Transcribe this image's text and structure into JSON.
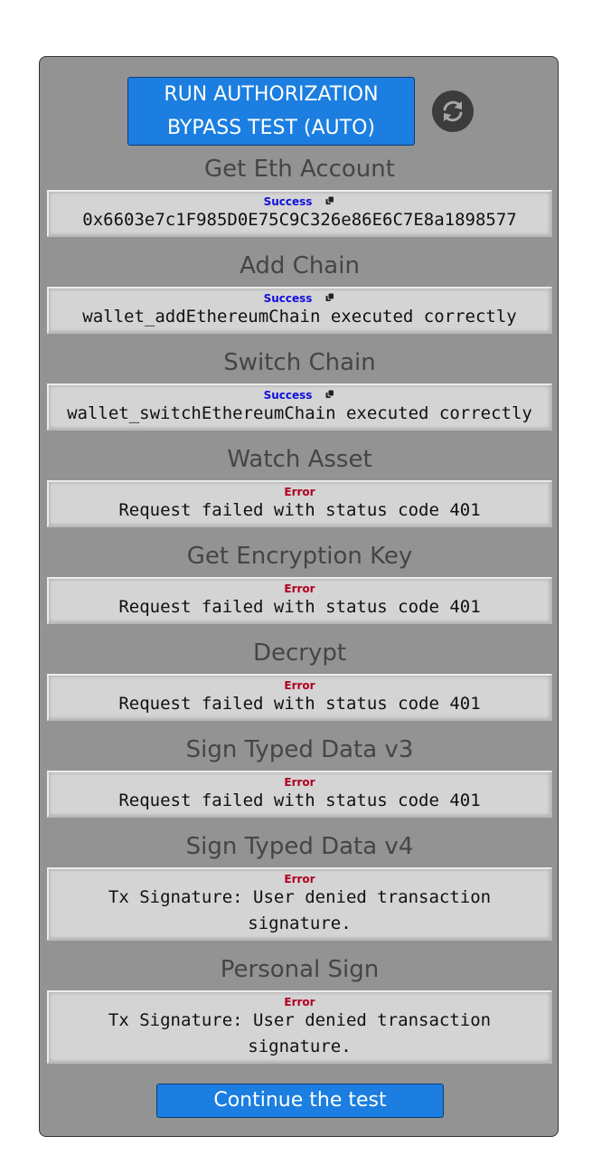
{
  "run_button": {
    "label": "RUN AUTHORIZATION BYPASS TEST (AUTO)"
  },
  "refresh_button": {
    "icon": "refresh-icon"
  },
  "sections": [
    {
      "title": "Get Eth Account",
      "status": "Success",
      "status_type": "success",
      "message": "0x6603e7c1F985D0E75C9C326e86E6C7E8a1898577",
      "copy_icon": "copy-icon"
    },
    {
      "title": "Add Chain",
      "status": "Success",
      "status_type": "success",
      "message": "wallet_addEthereumChain executed correctly",
      "copy_icon": "copy-icon"
    },
    {
      "title": "Switch Chain",
      "status": "Success",
      "status_type": "success",
      "message": "wallet_switchEthereumChain executed correctly",
      "copy_icon": "copy-icon"
    },
    {
      "title": "Watch Asset",
      "status": "Error",
      "status_type": "error",
      "message": "Request failed with status code 401"
    },
    {
      "title": "Get Encryption Key",
      "status": "Error",
      "status_type": "error",
      "message": "Request failed with status code 401"
    },
    {
      "title": "Decrypt",
      "status": "Error",
      "status_type": "error",
      "message": "Request failed with status code 401"
    },
    {
      "title": "Sign Typed Data v3",
      "status": "Error",
      "status_type": "error",
      "message": "Request failed with status code 401"
    },
    {
      "title": "Sign Typed Data v4",
      "status": "Error",
      "status_type": "error",
      "message": "Tx Signature: User denied transaction signature."
    },
    {
      "title": "Personal Sign",
      "status": "Error",
      "status_type": "error",
      "message": "Tx Signature: User denied transaction signature."
    }
  ],
  "continue_button": {
    "label": "Continue the test"
  },
  "colors": {
    "panel_bg": "#939393",
    "button_blue": "#1b7ee0",
    "success": "#1010dd",
    "error": "#b00020"
  }
}
